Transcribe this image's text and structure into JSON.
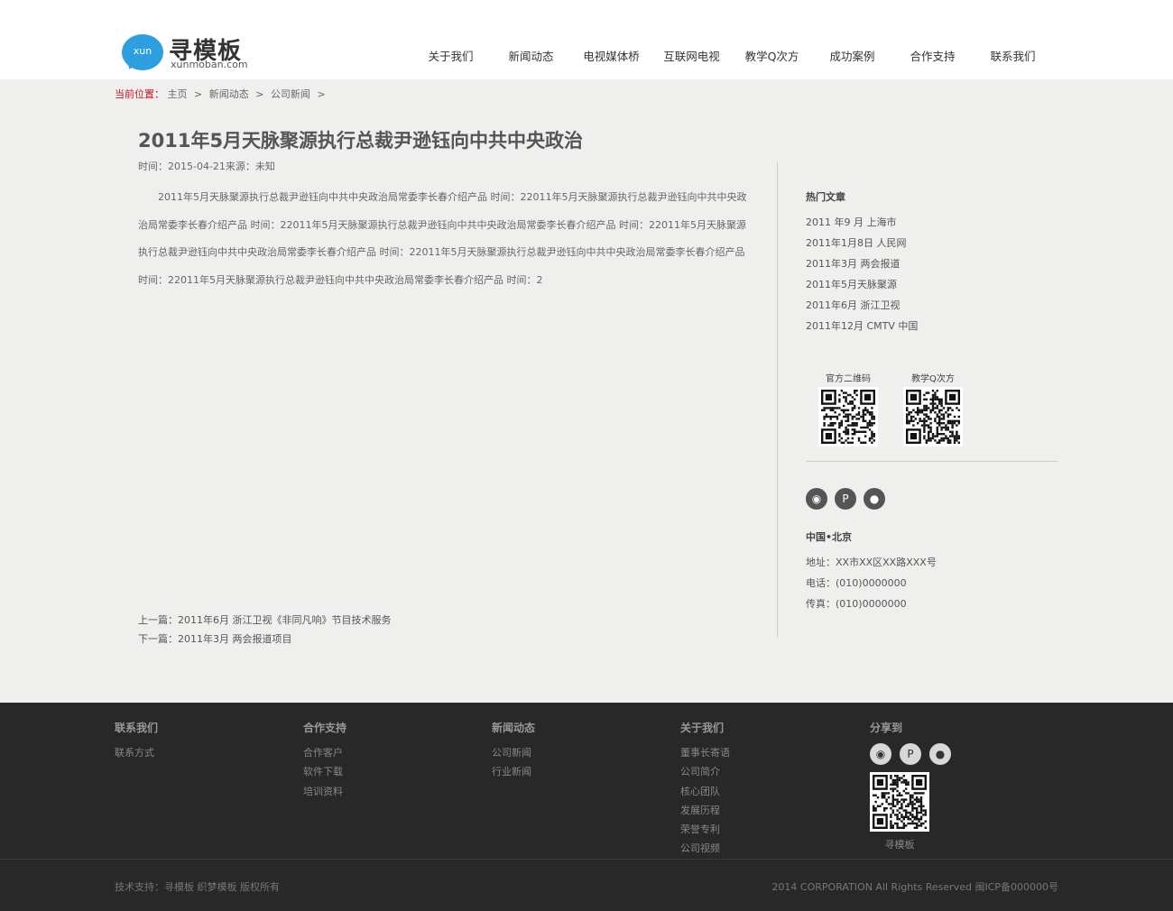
{
  "header": {
    "logo_badge": "xun",
    "logo_cn": "寻模板",
    "logo_en": "xunmoban.com",
    "nav": [
      "关于我们",
      "新闻动态",
      "电视媒体桥",
      "互联网电视",
      "教学Q次方",
      "成功案例",
      "合作支持",
      "联系我们"
    ]
  },
  "breadcrumb": {
    "label": "当前位置：",
    "items": [
      "主页",
      "新闻动态",
      "公司新闻"
    ],
    "sep": ">"
  },
  "article": {
    "title": "2011年5月天脉聚源执行总裁尹逊钰向中共中央政治",
    "meta": "时间：2015-04-21来源：未知",
    "body": "2011年5月天脉聚源执行总裁尹逊钰向中共中央政治局常委李长春介绍产品 时间：22011年5月天脉聚源执行总裁尹逊钰向中共中央政治局常委李长春介绍产品 时间：22011年5月天脉聚源执行总裁尹逊钰向中共中央政治局常委李长春介绍产品 时间：22011年5月天脉聚源执行总裁尹逊钰向中共中央政治局常委李长春介绍产品 时间：22011年5月天脉聚源执行总裁尹逊钰向中共中央政治局常委李长春介绍产品 时间：22011年5月天脉聚源执行总裁尹逊钰向中共中央政治局常委李长春介绍产品 时间：2",
    "prev": "上一篇：2011年6月 浙江卫视《非同凡响》节目技术服务",
    "next": "下一篇：2011年3月 两会报道项目"
  },
  "sidebar": {
    "hot_title": "热门文章",
    "hot": [
      "2011 年9 月 上海市",
      "2011年1月8日 人民网",
      "2011年3月 两会报道",
      "2011年5月天脉聚源",
      "2011年6月 浙江卫视",
      "2011年12月 CMTV 中国"
    ],
    "qr": [
      {
        "label": "官方二维码",
        "icon": "qr-code-icon"
      },
      {
        "label": "教学Q次方",
        "icon": "qr-code-icon"
      }
    ],
    "social": [
      {
        "icon": "weibo-icon",
        "glyph": "◉"
      },
      {
        "icon": "tencent-weibo-icon",
        "glyph": "P"
      },
      {
        "icon": "qq-icon",
        "glyph": "●"
      }
    ],
    "contact_title": "中国•北京",
    "address": "地址：XX市XX区XX路XXX号",
    "phone": "电话：(010)0000000",
    "fax": "传真：(010)0000000"
  },
  "footer": {
    "cols": [
      {
        "title": "联系我们",
        "items": [
          "联系方式"
        ]
      },
      {
        "title": "合作支持",
        "items": [
          "合作客户",
          "软件下载",
          "培训资料"
        ]
      },
      {
        "title": "新闻动态",
        "items": [
          "公司新闻",
          "行业新闻"
        ]
      },
      {
        "title": "关于我们",
        "items": [
          "董事长寄语",
          "公司简介",
          "核心团队",
          "发展历程",
          "荣誉专利",
          "公司视频"
        ]
      }
    ],
    "share_title": "分享到",
    "qr_label": "寻模板",
    "bottom_left": "技术支持：寻模板   织梦模板 版权所有",
    "bottom_right": "2014 CORPORATION All Rights Reserved 闽ICP备000000号"
  },
  "colors": {
    "accent_blue": "#2d9ee0",
    "breadcrumb_red": "#c9151e",
    "footer_bg": "#282828",
    "page_bg": "#efefee"
  }
}
